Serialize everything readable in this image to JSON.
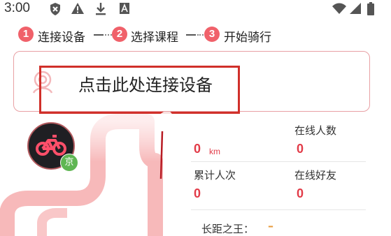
{
  "status_bar": {
    "time": "3:00",
    "icons_left": [
      "shield-x-icon",
      "warning-icon",
      "download-icon",
      "a-box-icon"
    ],
    "icons_right": [
      "wifi-icon",
      "signal-icon",
      "battery-icon"
    ]
  },
  "steps": [
    {
      "number": "1",
      "label": "连接设备"
    },
    {
      "number": "2",
      "label": "选择课程"
    },
    {
      "number": "3",
      "label": "开始骑行"
    }
  ],
  "connect_card": {
    "label": "点击此处连接设备",
    "icon": "bluetooth-ring-icon"
  },
  "profile": {
    "avatar_icon": "bicycle-icon",
    "city_badge": "京"
  },
  "stats": {
    "distance": {
      "value": "0",
      "unit": "km"
    },
    "online_people": {
      "label": "在线人数",
      "value": "0"
    },
    "total_rides": {
      "label": "累计人次",
      "value": "0"
    },
    "online_friends": {
      "label": "在线好友",
      "value": "0"
    },
    "long_distance_king": {
      "label": "长距之王：",
      "value": "–"
    }
  },
  "colors": {
    "accent": "#f0616a",
    "value_red": "#e23b48",
    "highlight_box": "#d0302a",
    "card_border": "#e8a0a4",
    "badge_green": "#5fb653"
  }
}
